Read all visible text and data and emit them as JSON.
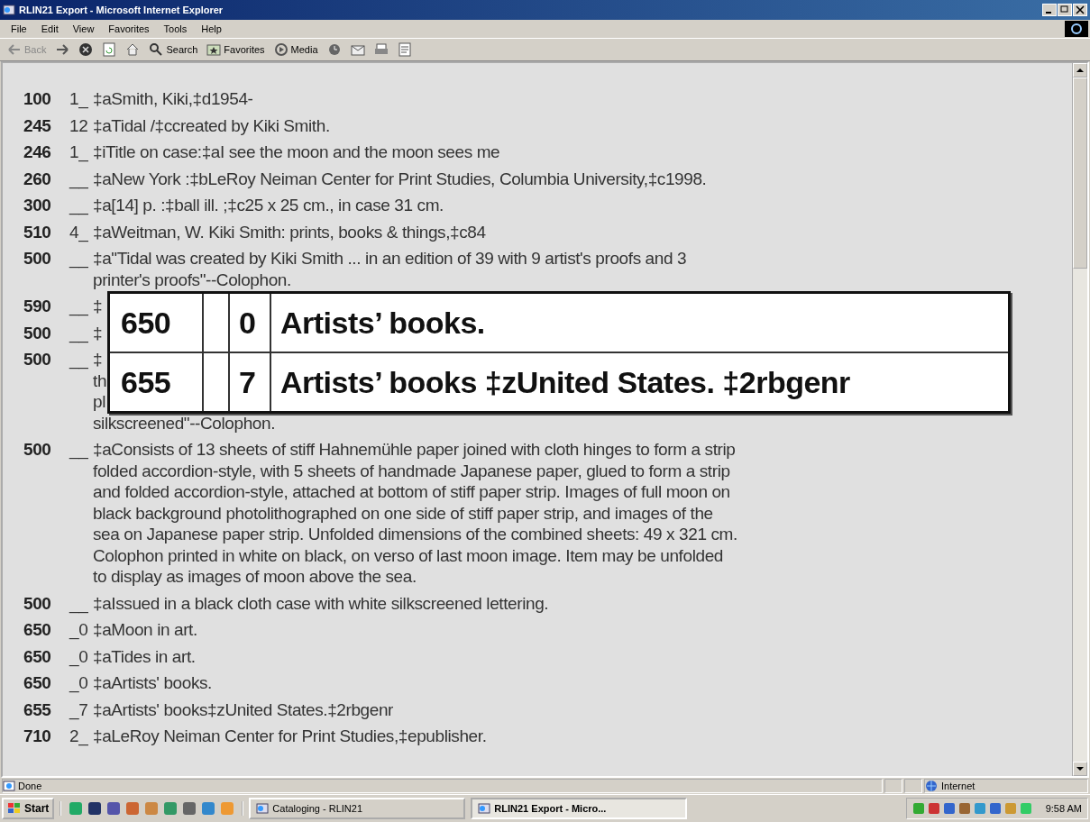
{
  "window": {
    "title": "RLIN21 Export - Microsoft Internet Explorer"
  },
  "menu": [
    "File",
    "Edit",
    "View",
    "Favorites",
    "Tools",
    "Help"
  ],
  "toolbar": [
    {
      "kind": "back",
      "label": "Back"
    },
    {
      "kind": "forward"
    },
    {
      "kind": "stop"
    },
    {
      "kind": "refresh"
    },
    {
      "kind": "home"
    },
    {
      "kind": "search",
      "label": "Search"
    },
    {
      "kind": "favorites",
      "label": "Favorites"
    },
    {
      "kind": "media",
      "label": "Media"
    },
    {
      "kind": "history"
    },
    {
      "kind": "mail"
    },
    {
      "kind": "print"
    },
    {
      "kind": "edit"
    }
  ],
  "records": [
    {
      "tag": "100",
      "ind": "1_",
      "text": "‡aSmith, Kiki,‡d1954-"
    },
    {
      "tag": "245",
      "ind": "12",
      "text": "‡aTidal /‡ccreated by Kiki Smith."
    },
    {
      "tag": "246",
      "ind": "1_",
      "text": "‡iTitle on case:‡aI see the moon and the moon sees me"
    },
    {
      "tag": "260",
      "ind": "__",
      "text": "‡aNew York :‡bLeRoy Neiman Center for Print Studies, Columbia University,‡c1998."
    },
    {
      "tag": "300",
      "ind": "__",
      "text": "‡a[14] p. :‡ball ill. ;‡c25 x 25 cm., in case 31 cm."
    },
    {
      "tag": "510",
      "ind": "4_",
      "text": "‡aWeitman, W. Kiki Smith: prints, books & things,‡c84"
    },
    {
      "tag": "500",
      "ind": "__",
      "text": "‡a\"Tidal was created by Kiki Smith ... in an edition of 39 with 9 artist's proofs and 3 printer's proofs\"--Colophon."
    },
    {
      "tag": "590",
      "ind": "__",
      "fragments": [
        "‡"
      ]
    },
    {
      "tag": "500",
      "ind": "__",
      "fragments": [
        "‡"
      ]
    },
    {
      "tag": "500",
      "ind": "__",
      "fragments": [
        "‡",
        "th",
        "pl",
        "silkscreened\"--Colophon."
      ]
    },
    {
      "tag": "500",
      "ind": "__",
      "text": "‡aConsists of 13 sheets of stiff Hahnemühle paper joined with cloth hinges to form a strip folded accordion-style, with 5 sheets of handmade Japanese paper, glued to form a strip and folded accordion-style, attached at bottom of stiff paper strip. Images of full moon on black background photolithographed on one side of stiff paper strip, and images of the sea on Japanese paper strip. Unfolded dimensions of the combined sheets: 49 x 321 cm. Colophon printed in white on black, on verso of last moon image. Item may be unfolded to display as images of moon above the sea."
    },
    {
      "tag": "500",
      "ind": "__",
      "text": "‡aIssued in a black cloth case with white silkscreened lettering."
    },
    {
      "tag": "650",
      "ind": "_0",
      "text": "‡aMoon in art."
    },
    {
      "tag": "650",
      "ind": "_0",
      "text": "‡aTides in art."
    },
    {
      "tag": "650",
      "ind": "_0",
      "text": "‡aArtists' books."
    },
    {
      "tag": "655",
      "ind": "_7",
      "text": "‡aArtists' books‡zUnited States.‡2rbgenr"
    },
    {
      "tag": "710",
      "ind": "2_",
      "text": "‡aLeRoy Neiman Center for Print Studies,‡epublisher."
    }
  ],
  "callout": [
    {
      "tag": "650",
      "ind2": "0",
      "text": "Artists’ books."
    },
    {
      "tag": "655",
      "ind2": "7",
      "text": "Artists’ books ‡zUnited States. ‡2rbgenr"
    }
  ],
  "status_bar": {
    "text": "Done",
    "zone": "Internet"
  },
  "taskbar": {
    "start": "Start",
    "tasks": [
      {
        "label": "Cataloging - RLIN21",
        "selected": false
      },
      {
        "label": "RLIN21 Export - Micro...",
        "selected": true
      }
    ],
    "clock": "9:58 AM"
  }
}
